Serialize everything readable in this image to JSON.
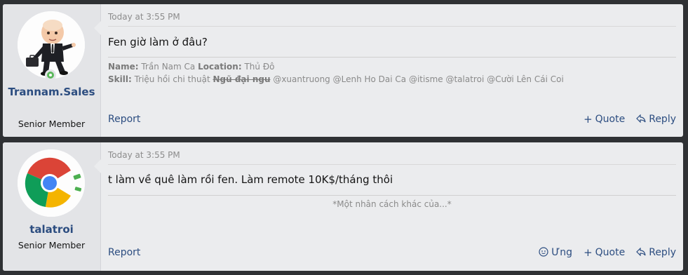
{
  "posts": [
    {
      "username": "Trannam.Sales",
      "user_title": "Senior Member",
      "time": "Today at 3:55 PM",
      "message": "Fen giờ làm ở đâu?",
      "signature": {
        "name_label": "Name:",
        "name_value": "Trần Nam Ca",
        "location_label": "Location:",
        "location_value": "Thủ Đô",
        "skill_label": "Skill:",
        "skill_value": "Triệu hồi chi thuật",
        "skill_struck": "Ngũ đại ngu",
        "mentions": "@xuantruong @Lenh Ho Dai Ca @itisme @talatroi @Cười Lên Cái Coi"
      },
      "actions": {
        "report": "Report",
        "quote": "Quote",
        "reply": "Reply"
      }
    },
    {
      "username": "talatroi",
      "user_title": "Senior Member",
      "time": "Today at 3:55 PM",
      "message": "t làm về quê làm rồi fen. Làm remote 10K$/tháng thôi",
      "signature_text": "*Một nhân cách khác của...*",
      "actions": {
        "report": "Report",
        "ung": "Ưng",
        "quote": "Quote",
        "reply": "Reply"
      }
    }
  ],
  "icons": {
    "quote": "plus-icon",
    "reply": "reply-icon",
    "ung": "like-icon",
    "online": "online-status-icon"
  },
  "colors": {
    "background": "#2f3134",
    "post_bg": "#ebecee",
    "user_cell_bg": "#e3e4e7",
    "link": "#2c4d80",
    "online": "#5cb85c"
  }
}
